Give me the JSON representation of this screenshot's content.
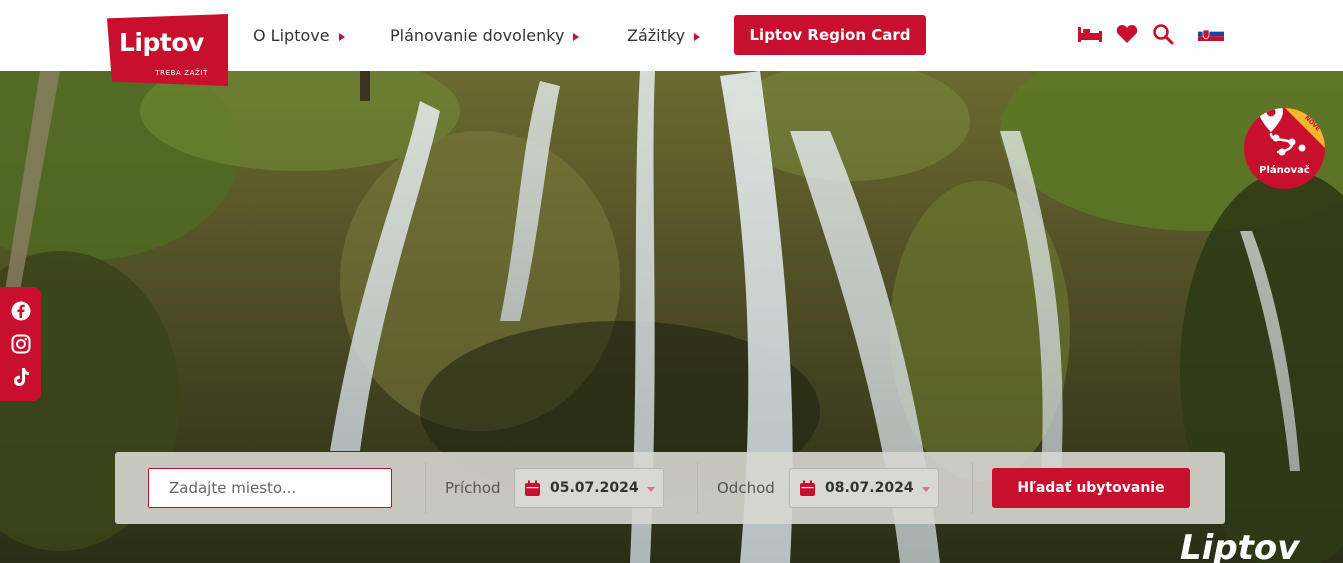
{
  "header": {
    "logo_text": "Liptov",
    "logo_tagline": "TREBA ZAŽIŤ",
    "nav": [
      {
        "label": "O Liptove"
      },
      {
        "label": "Plánovanie dovolenky"
      },
      {
        "label": "Zážitky"
      }
    ],
    "region_card_label": "Liptov Region Card",
    "icons": [
      "bed-icon",
      "heart-icon",
      "search-icon",
      "slovak-flag-icon"
    ]
  },
  "social": [
    "facebook-icon",
    "instagram-icon",
    "tiktok-icon"
  ],
  "planner": {
    "label": "Plánovač",
    "badge": "NOVÉ"
  },
  "search": {
    "place_placeholder": "Zadajte miesto...",
    "arrival_label": "Príchod",
    "arrival_date": "05.07.2024",
    "departure_label": "Odchod",
    "departure_date": "08.07.2024",
    "submit_label": "Hľadať ubytovanie"
  },
  "watermark": "Liptov",
  "colors": {
    "brand_red": "#c8102e",
    "accent_yellow": "#f5b52c"
  }
}
